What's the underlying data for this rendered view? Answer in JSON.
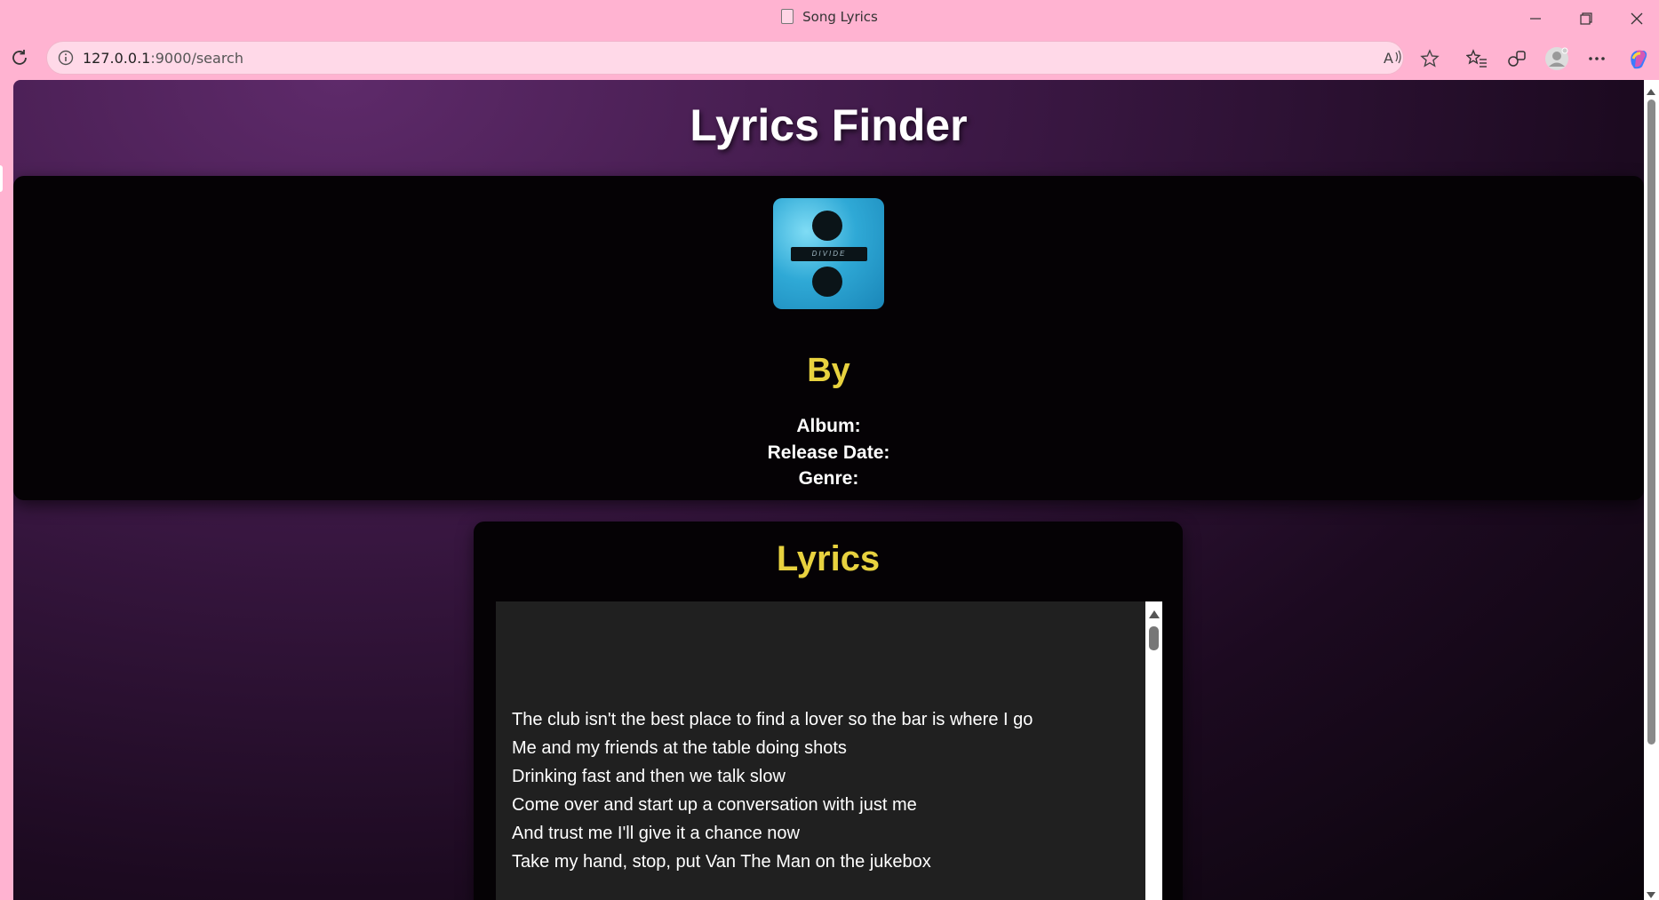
{
  "window": {
    "title": "Song Lyrics"
  },
  "address_bar": {
    "host": "127.0.0.1",
    "path": ":9000/search"
  },
  "page": {
    "heading": "Lyrics Finder",
    "song": {
      "by_label": "By",
      "album_label": "Album:",
      "release_label": "Release Date:",
      "genre_label": "Genre:",
      "cover_text": "DIVIDE"
    },
    "lyrics": {
      "heading": "Lyrics",
      "lines": [
        "The club isn't the best place to find a lover so the bar is where I go",
        "Me and my friends at the table doing shots",
        "Drinking fast and then we talk slow",
        "Come over and start up a conversation with just me",
        "And trust me I'll give it a chance now",
        "Take my hand, stop, put Van The Man on the jukebox"
      ]
    }
  },
  "colors": {
    "browser_chrome": "#ffb3d1",
    "accent_yellow": "#e8d23f",
    "card_bg": "#050205",
    "lyrics_box_bg": "#202020"
  }
}
